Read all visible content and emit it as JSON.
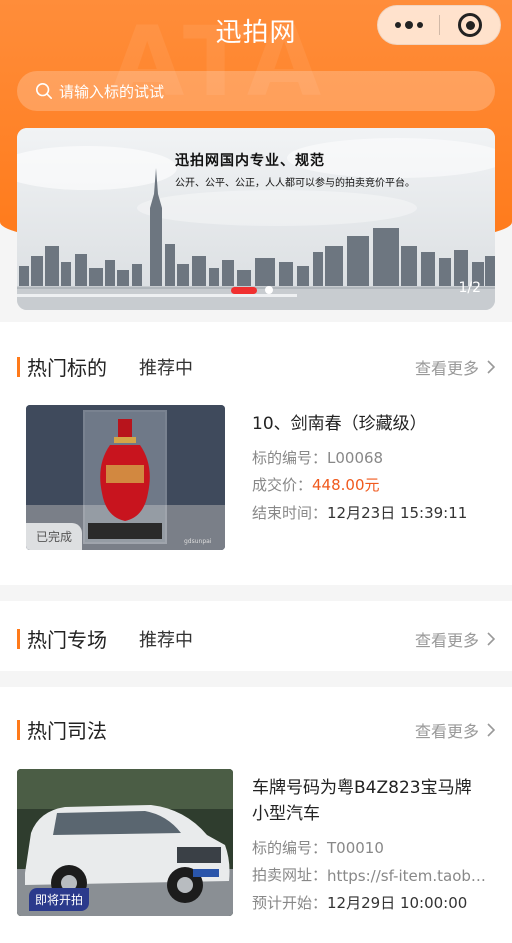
{
  "header": {
    "title": "迅拍网",
    "watermark": "ATA"
  },
  "search": {
    "placeholder": "请输入标的试试"
  },
  "banner": {
    "title": "迅拍网国内专业、规范",
    "subtitle": "公开、公平、公正，人人都可以参与的拍卖竞价平台。",
    "pager": "1/2",
    "image_watermark": "gdsunpai"
  },
  "sections": [
    {
      "title": "热门标的",
      "tag": "推荐中",
      "more": "查看更多",
      "item": {
        "badge": "已完成",
        "name": "10、剑南春（珍藏级）",
        "code_label": "标的编号：",
        "code": "L00068",
        "price_label": "成交价：",
        "price": "448.00元",
        "end_label": "结束时间：",
        "end_time": "12月23日 15:39:11"
      }
    },
    {
      "title": "热门专场",
      "tag": "推荐中",
      "more": "查看更多"
    },
    {
      "title": "热门司法",
      "more": "查看更多",
      "item": {
        "badge": "即将开拍",
        "name_line1": "车牌号码为粤B4Z823宝马牌",
        "name_line2": "小型汽车",
        "code_label": "标的编号：",
        "code": "T00010",
        "url_label": "拍卖网址：",
        "url": "https://sf-item.taob…",
        "start_label": "预计开始：",
        "start_time": "12月29日 10:00:00"
      }
    }
  ],
  "colors": {
    "accent": "#ff7a1a",
    "price": "#f05a1e",
    "badge_blue": "#2b3a8c"
  }
}
